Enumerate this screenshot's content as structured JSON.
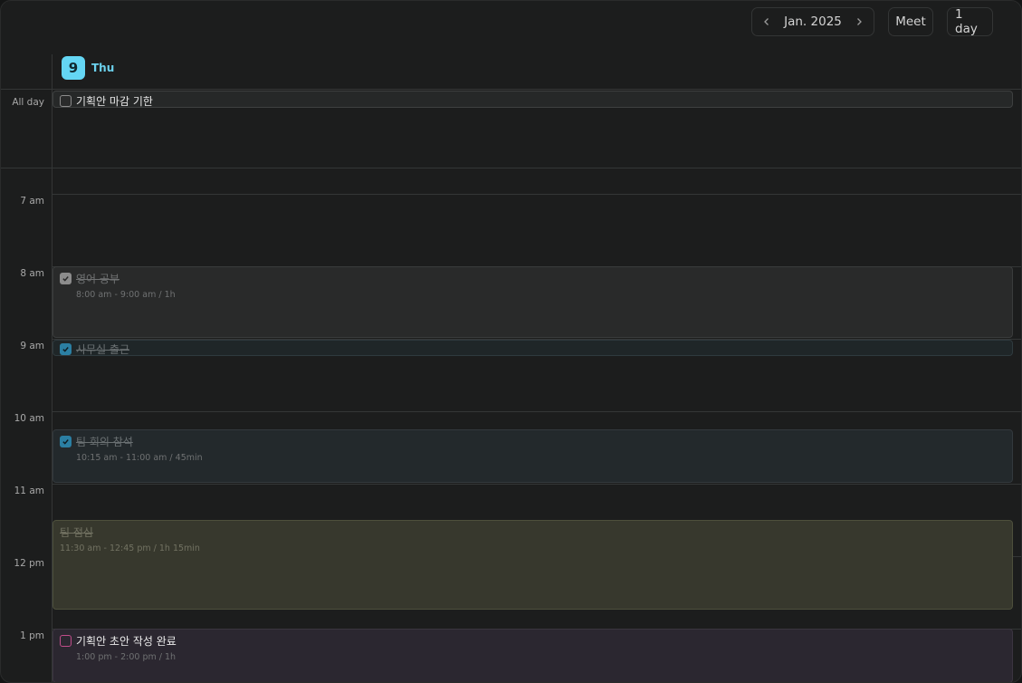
{
  "toolbar": {
    "month": "Jan. 2025",
    "meet_label": "Meet",
    "view_label": "1 day"
  },
  "day": {
    "number": "9",
    "name": "Thu"
  },
  "allday_label": "All day",
  "time_labels": [
    "7 am",
    "8 am",
    "9 am",
    "10 am",
    "11 am",
    "12 pm",
    "1 pm"
  ],
  "events": {
    "allday": {
      "title": "기획안 마감 기한",
      "checked": false
    },
    "english": {
      "title": "영어 공부",
      "time": "8:00 am - 9:00 am / 1h",
      "checked": true
    },
    "office": {
      "title": "사무실 출근",
      "checked": true
    },
    "meeting": {
      "title": "팀 회의 참석",
      "time": "10:15 am - 11:00 am / 45min",
      "checked": true
    },
    "lunch": {
      "title": "팀 점심",
      "time": "11:30 am - 12:45 pm / 1h 15min"
    },
    "draft": {
      "title": "기획안 초안 작성 완료",
      "time": "1:00 pm - 2:00 pm / 1h",
      "checked": false
    }
  },
  "colors": {
    "accent": "#64d6f4",
    "check_gray": "#8c8c8c",
    "check_blue": "#2b7fa3",
    "check_pink": "#c04d8a",
    "lunch_bg": "#37382d",
    "draft_bg": "#2b2730"
  }
}
